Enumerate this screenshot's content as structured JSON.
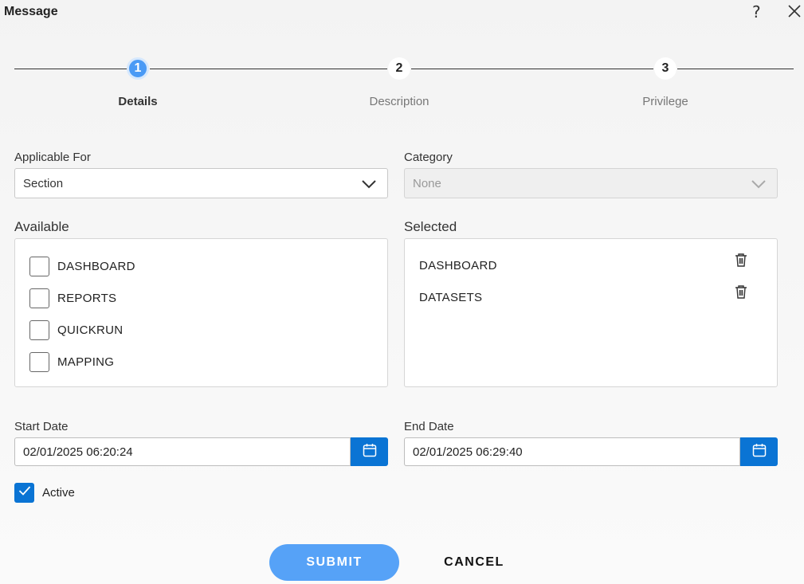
{
  "dialog": {
    "title": "Message"
  },
  "stepper": {
    "steps": [
      {
        "number": "1",
        "label": "Details"
      },
      {
        "number": "2",
        "label": "Description"
      },
      {
        "number": "3",
        "label": "Privilege"
      }
    ],
    "active_step": 1
  },
  "form": {
    "applicable_for": {
      "label": "Applicable For",
      "value": "Section"
    },
    "category": {
      "label": "Category",
      "value": "None",
      "disabled": true
    },
    "available": {
      "label": "Available",
      "items": [
        {
          "label": "DASHBOARD",
          "checked": false
        },
        {
          "label": "REPORTS",
          "checked": false
        },
        {
          "label": "QUICKRUN",
          "checked": false
        },
        {
          "label": "MAPPING",
          "checked": false
        }
      ]
    },
    "selected": {
      "label": "Selected",
      "items": [
        {
          "label": "DASHBOARD"
        },
        {
          "label": "DATASETS"
        }
      ]
    },
    "start_date": {
      "label": "Start Date",
      "value": "02/01/2025 06:20:24"
    },
    "end_date": {
      "label": "End Date",
      "value": "02/01/2025 06:29:40"
    },
    "active": {
      "label": "Active",
      "checked": true
    }
  },
  "actions": {
    "submit_label": "SUBMIT",
    "cancel_label": "CANCEL"
  },
  "colors": {
    "accent": "#0a74d4",
    "step_active": "#4a9af5",
    "submit": "#56a2f7"
  },
  "icons": [
    "help-icon",
    "close-icon",
    "chevron-down-icon",
    "trash-icon",
    "calendar-icon",
    "check-icon"
  ]
}
